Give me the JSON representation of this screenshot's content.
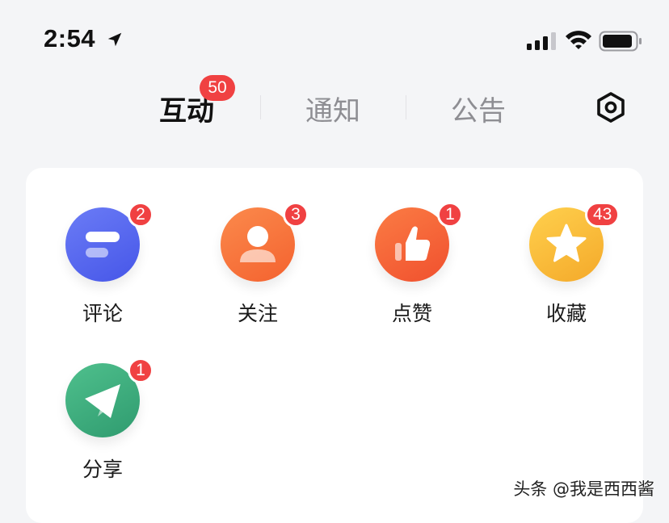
{
  "status_bar": {
    "time": "2:54",
    "icons": [
      "location-arrow-icon",
      "cellular-signal-icon",
      "wifi-icon",
      "battery-icon"
    ]
  },
  "tabs": [
    {
      "label": "互动",
      "active": true,
      "badge": "50"
    },
    {
      "label": "通知",
      "active": false
    },
    {
      "label": "公告",
      "active": false
    }
  ],
  "header": {
    "settings_icon": "settings-icon"
  },
  "items": [
    {
      "label": "评论",
      "badge": "2",
      "icon": "comment-icon",
      "color": "#5b6cf0"
    },
    {
      "label": "关注",
      "badge": "3",
      "icon": "user-icon",
      "color": "#f7773b"
    },
    {
      "label": "点赞",
      "badge": "1",
      "icon": "thumbs-up-icon",
      "color": "#f7663a"
    },
    {
      "label": "收藏",
      "badge": "43",
      "icon": "star-icon",
      "color": "#f8be3b"
    },
    {
      "label": "分享",
      "badge": "1",
      "icon": "share-paper-plane-icon",
      "color": "#3fae7f"
    }
  ],
  "watermark": "头条 @我是西西酱",
  "colors": {
    "badge": "#f04142",
    "background": "#f4f5f7",
    "card": "#ffffff",
    "inactive_tab": "#8e8e93"
  }
}
